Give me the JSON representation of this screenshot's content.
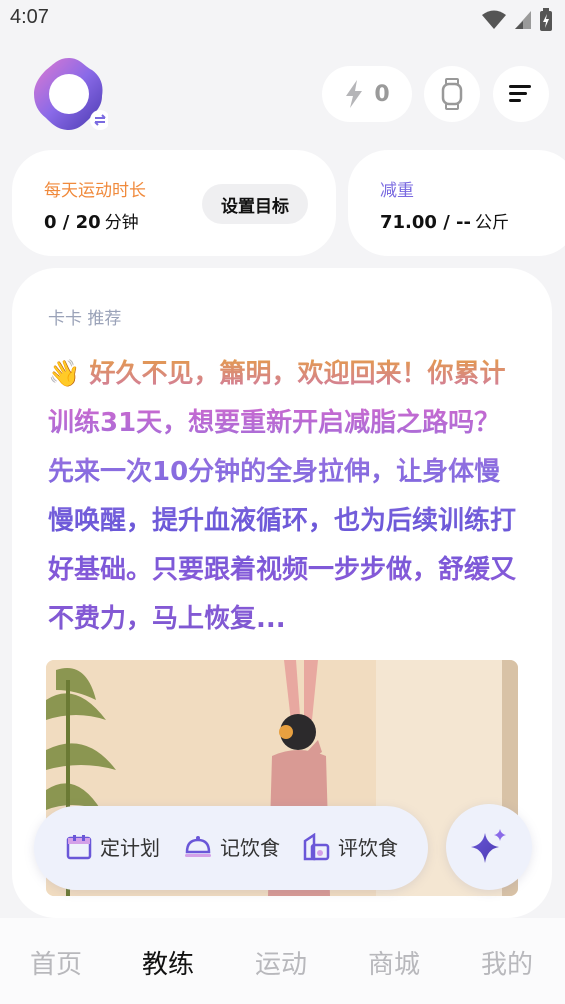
{
  "status_bar": {
    "time": "4:07"
  },
  "header": {
    "energy_count": "0"
  },
  "goals": [
    {
      "label": "每天运动时长",
      "value": "0 / 20",
      "unit": "分钟",
      "action": "设置目标",
      "label_color": "#f08a3c"
    },
    {
      "label": "减重",
      "value": "71.00 / --",
      "unit": "公斤",
      "label_color": "#7a6ae0"
    }
  ],
  "recommendation": {
    "label": "卡卡 推荐",
    "emoji": "👋",
    "text": "好久不见，簫明，欢迎回来！你累计训练31天，想要重新开启减脂之路吗？先来一次10分钟的全身拉伸，让身体慢慢唤醒，提升血液循环，也为后续训练打好基础。只要跟着视频一步步做，舒缓又不费力，马上恢复..."
  },
  "actions": [
    {
      "label": "定计划",
      "icon": "calendar-icon"
    },
    {
      "label": "记饮食",
      "icon": "dish-cover-icon"
    },
    {
      "label": "评饮食",
      "icon": "food-rating-icon"
    }
  ],
  "nav": [
    {
      "label": "首页",
      "active": false
    },
    {
      "label": "教练",
      "active": true
    },
    {
      "label": "运动",
      "active": false
    },
    {
      "label": "商城",
      "active": false
    },
    {
      "label": "我的",
      "active": false
    }
  ],
  "colors": {
    "accent": "#6a57d8",
    "orange": "#f08a3c",
    "purple": "#7a6ae0"
  }
}
